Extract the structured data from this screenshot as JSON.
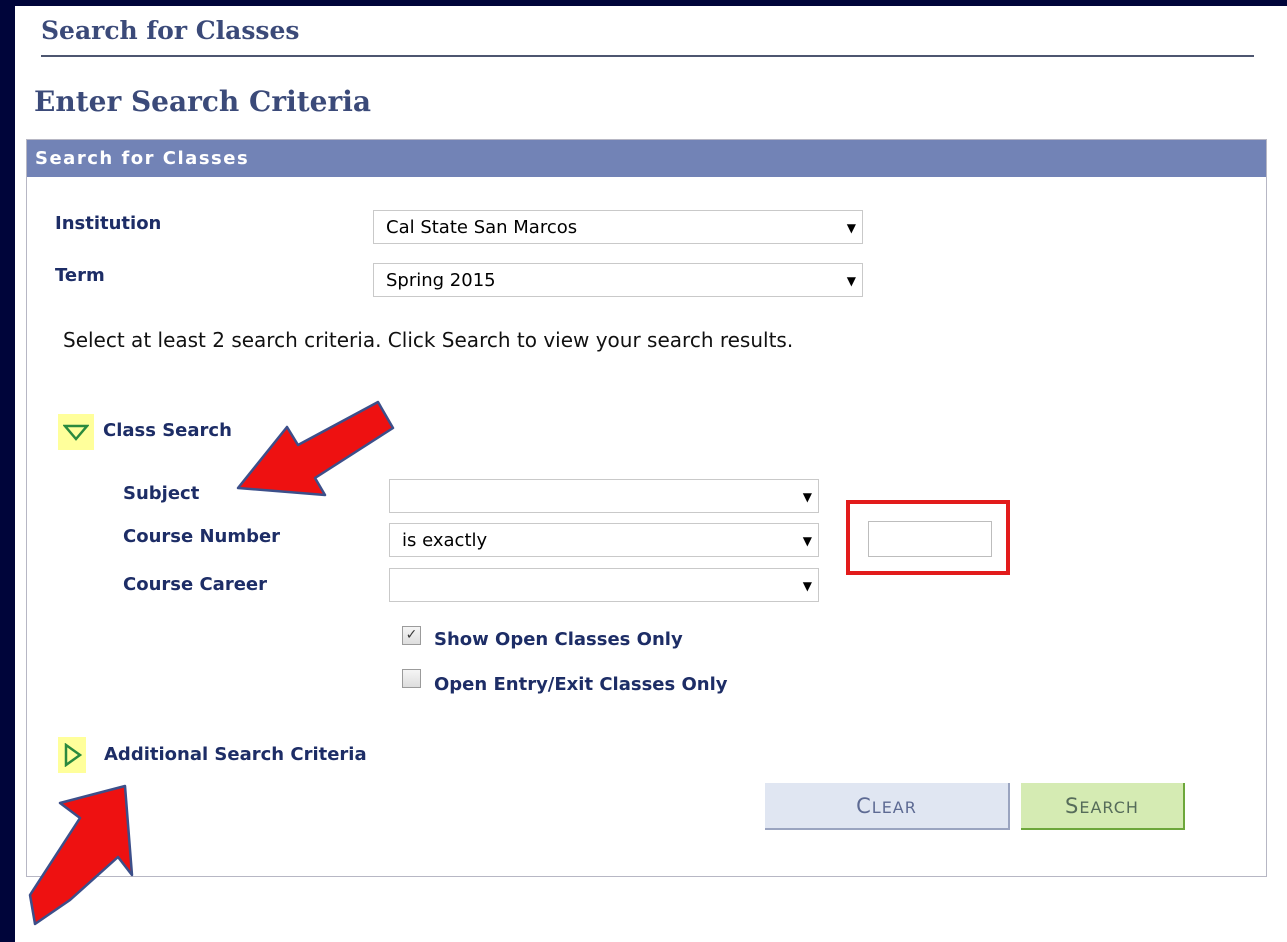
{
  "header": {
    "page_title": "Search for Classes",
    "section_title": "Enter Search Criteria",
    "panel_title": "Search for Classes"
  },
  "form": {
    "institution_label": "Institution",
    "institution_value": "Cal State San Marcos",
    "term_label": "Term",
    "term_value": "Spring 2015",
    "instruction": "Select at least 2 search criteria. Click Search to view your search results."
  },
  "class_search": {
    "toggle_label": "Class Search",
    "subject_label": "Subject",
    "subject_value": "",
    "course_number_label": "Course Number",
    "course_number_operator": "is exactly",
    "course_number_value": "",
    "course_career_label": "Course Career",
    "course_career_value": "",
    "show_open_label": "Show Open Classes Only",
    "show_open_checked": true,
    "open_entry_label": "Open Entry/Exit Classes Only",
    "open_entry_checked": false
  },
  "additional": {
    "toggle_label": "Additional Search Criteria"
  },
  "buttons": {
    "clear_first": "C",
    "clear_rest": "LEAR",
    "search_first": "S",
    "search_rest": "EARCH"
  },
  "colors": {
    "frame": "#00053a",
    "panel_header": "#7283b6",
    "label": "#1d2d66",
    "highlight_arrow": "#e21b1b",
    "toggle_bg": "#ffff9b"
  }
}
